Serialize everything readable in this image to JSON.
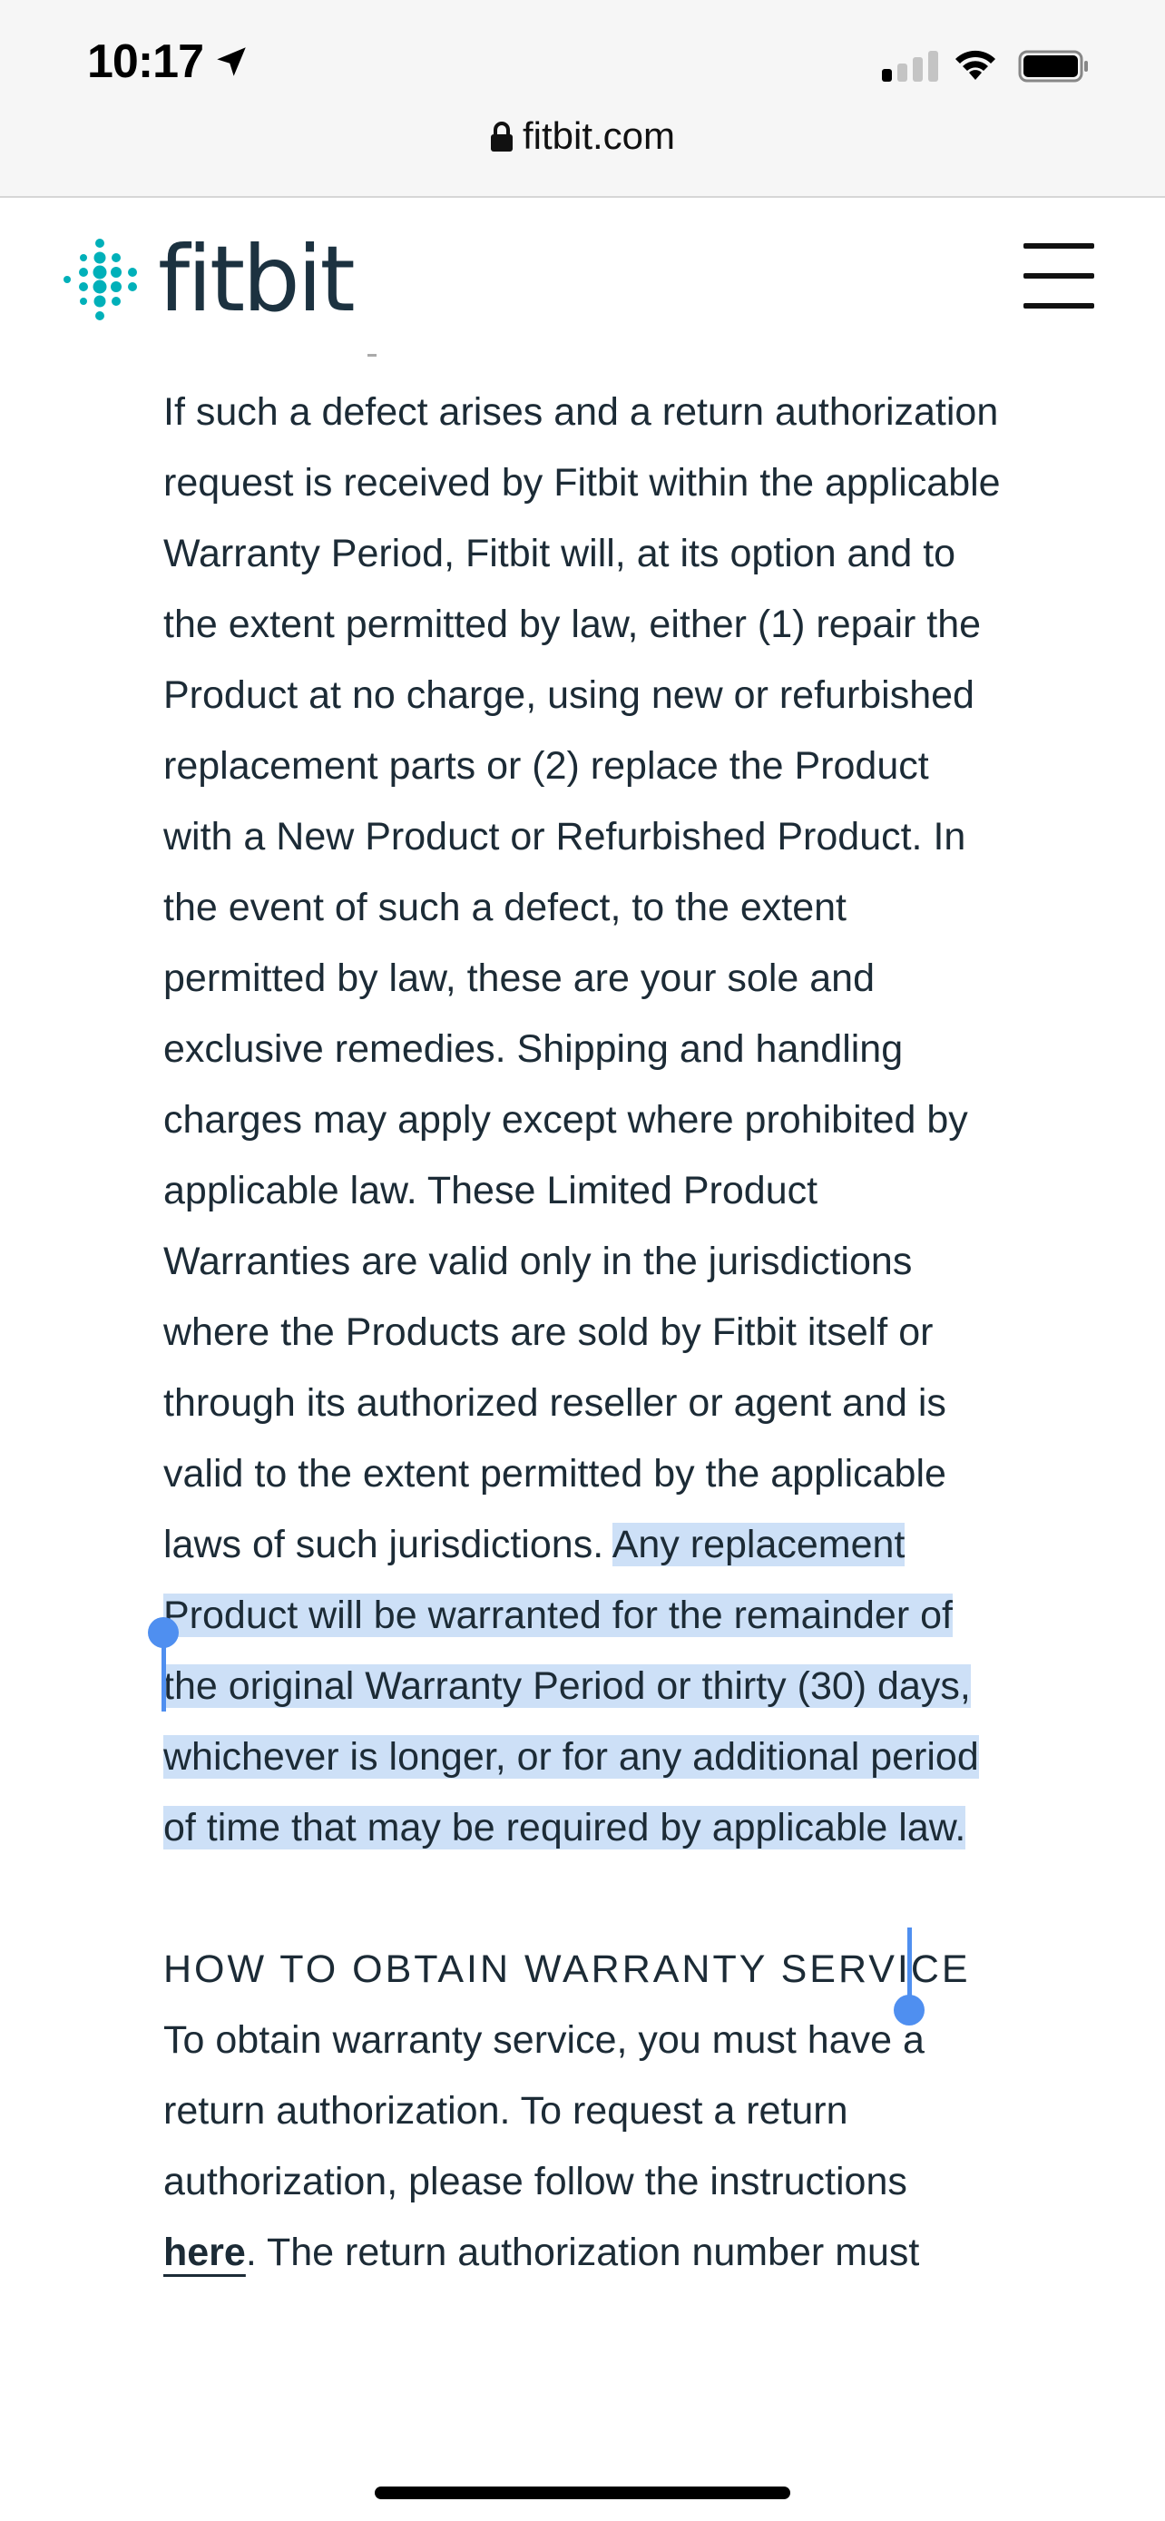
{
  "status_bar": {
    "time": "10:17",
    "location_icon": "location-arrow-icon",
    "signal_icon": "cellular-signal-icon",
    "wifi_icon": "wifi-icon",
    "battery_icon": "battery-icon"
  },
  "browser": {
    "url": "fitbit.com",
    "lock_icon": "lock-icon"
  },
  "header": {
    "logo_text": "fitbit",
    "menu_icon": "hamburger-menu-icon"
  },
  "content": {
    "paragraph_main": "If such a defect arises and a return authorization request is received by Fitbit within the applicable Warranty Period, Fitbit will, at its option and to the extent permitted by law, either (1) repair the Product at no charge, using new or refurbished replacement parts or (2) replace the Product with a New Product or Refurbished Product. In the event of such a defect, to the extent permitted by law, these are your sole and exclusive remedies. Shipping and handling charges may apply except where prohibited by applicable law. These Limited Product Warranties are valid only in the jurisdictions where the Products are sold by Fitbit itself or through its authorized reseller or agent and is valid to the extent permitted by the applicable laws of such jurisdictions.",
    "paragraph_selected": "Any replacement Product will be warranted for the remainder of the original Warranty Period or thirty (30) days, whichever is longer, or for any additional period of time that may be required by applicable law.",
    "section_title": "HOW TO OBTAIN WARRANTY SERVICE",
    "service_text_before_link": "To obtain warranty service, you must have a return authorization. To request a return authorization, please follow the instructions ",
    "service_link": "here",
    "service_text_after_link": ". The return authorization number must"
  },
  "colors": {
    "selection": "#cde0f7",
    "handle": "#4f8ff0",
    "text": "#1c2b36",
    "logo_teal": "#00b0b9"
  }
}
